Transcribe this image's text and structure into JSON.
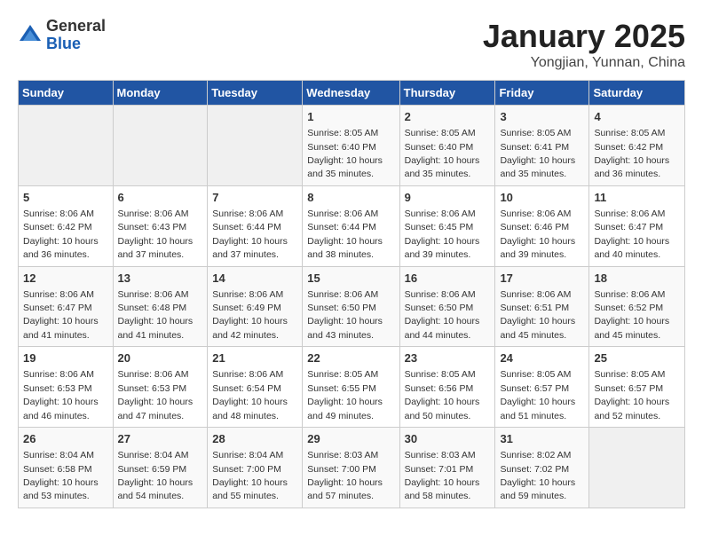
{
  "logo": {
    "general": "General",
    "blue": "Blue"
  },
  "title": "January 2025",
  "location": "Yongjian, Yunnan, China",
  "days_of_week": [
    "Sunday",
    "Monday",
    "Tuesday",
    "Wednesday",
    "Thursday",
    "Friday",
    "Saturday"
  ],
  "weeks": [
    [
      {
        "day": "",
        "info": ""
      },
      {
        "day": "",
        "info": ""
      },
      {
        "day": "",
        "info": ""
      },
      {
        "day": "1",
        "info": "Sunrise: 8:05 AM\nSunset: 6:40 PM\nDaylight: 10 hours and 35 minutes."
      },
      {
        "day": "2",
        "info": "Sunrise: 8:05 AM\nSunset: 6:40 PM\nDaylight: 10 hours and 35 minutes."
      },
      {
        "day": "3",
        "info": "Sunrise: 8:05 AM\nSunset: 6:41 PM\nDaylight: 10 hours and 35 minutes."
      },
      {
        "day": "4",
        "info": "Sunrise: 8:05 AM\nSunset: 6:42 PM\nDaylight: 10 hours and 36 minutes."
      }
    ],
    [
      {
        "day": "5",
        "info": "Sunrise: 8:06 AM\nSunset: 6:42 PM\nDaylight: 10 hours and 36 minutes."
      },
      {
        "day": "6",
        "info": "Sunrise: 8:06 AM\nSunset: 6:43 PM\nDaylight: 10 hours and 37 minutes."
      },
      {
        "day": "7",
        "info": "Sunrise: 8:06 AM\nSunset: 6:44 PM\nDaylight: 10 hours and 37 minutes."
      },
      {
        "day": "8",
        "info": "Sunrise: 8:06 AM\nSunset: 6:44 PM\nDaylight: 10 hours and 38 minutes."
      },
      {
        "day": "9",
        "info": "Sunrise: 8:06 AM\nSunset: 6:45 PM\nDaylight: 10 hours and 39 minutes."
      },
      {
        "day": "10",
        "info": "Sunrise: 8:06 AM\nSunset: 6:46 PM\nDaylight: 10 hours and 39 minutes."
      },
      {
        "day": "11",
        "info": "Sunrise: 8:06 AM\nSunset: 6:47 PM\nDaylight: 10 hours and 40 minutes."
      }
    ],
    [
      {
        "day": "12",
        "info": "Sunrise: 8:06 AM\nSunset: 6:47 PM\nDaylight: 10 hours and 41 minutes."
      },
      {
        "day": "13",
        "info": "Sunrise: 8:06 AM\nSunset: 6:48 PM\nDaylight: 10 hours and 41 minutes."
      },
      {
        "day": "14",
        "info": "Sunrise: 8:06 AM\nSunset: 6:49 PM\nDaylight: 10 hours and 42 minutes."
      },
      {
        "day": "15",
        "info": "Sunrise: 8:06 AM\nSunset: 6:50 PM\nDaylight: 10 hours and 43 minutes."
      },
      {
        "day": "16",
        "info": "Sunrise: 8:06 AM\nSunset: 6:50 PM\nDaylight: 10 hours and 44 minutes."
      },
      {
        "day": "17",
        "info": "Sunrise: 8:06 AM\nSunset: 6:51 PM\nDaylight: 10 hours and 45 minutes."
      },
      {
        "day": "18",
        "info": "Sunrise: 8:06 AM\nSunset: 6:52 PM\nDaylight: 10 hours and 45 minutes."
      }
    ],
    [
      {
        "day": "19",
        "info": "Sunrise: 8:06 AM\nSunset: 6:53 PM\nDaylight: 10 hours and 46 minutes."
      },
      {
        "day": "20",
        "info": "Sunrise: 8:06 AM\nSunset: 6:53 PM\nDaylight: 10 hours and 47 minutes."
      },
      {
        "day": "21",
        "info": "Sunrise: 8:06 AM\nSunset: 6:54 PM\nDaylight: 10 hours and 48 minutes."
      },
      {
        "day": "22",
        "info": "Sunrise: 8:05 AM\nSunset: 6:55 PM\nDaylight: 10 hours and 49 minutes."
      },
      {
        "day": "23",
        "info": "Sunrise: 8:05 AM\nSunset: 6:56 PM\nDaylight: 10 hours and 50 minutes."
      },
      {
        "day": "24",
        "info": "Sunrise: 8:05 AM\nSunset: 6:57 PM\nDaylight: 10 hours and 51 minutes."
      },
      {
        "day": "25",
        "info": "Sunrise: 8:05 AM\nSunset: 6:57 PM\nDaylight: 10 hours and 52 minutes."
      }
    ],
    [
      {
        "day": "26",
        "info": "Sunrise: 8:04 AM\nSunset: 6:58 PM\nDaylight: 10 hours and 53 minutes."
      },
      {
        "day": "27",
        "info": "Sunrise: 8:04 AM\nSunset: 6:59 PM\nDaylight: 10 hours and 54 minutes."
      },
      {
        "day": "28",
        "info": "Sunrise: 8:04 AM\nSunset: 7:00 PM\nDaylight: 10 hours and 55 minutes."
      },
      {
        "day": "29",
        "info": "Sunrise: 8:03 AM\nSunset: 7:00 PM\nDaylight: 10 hours and 57 minutes."
      },
      {
        "day": "30",
        "info": "Sunrise: 8:03 AM\nSunset: 7:01 PM\nDaylight: 10 hours and 58 minutes."
      },
      {
        "day": "31",
        "info": "Sunrise: 8:02 AM\nSunset: 7:02 PM\nDaylight: 10 hours and 59 minutes."
      },
      {
        "day": "",
        "info": ""
      }
    ]
  ]
}
